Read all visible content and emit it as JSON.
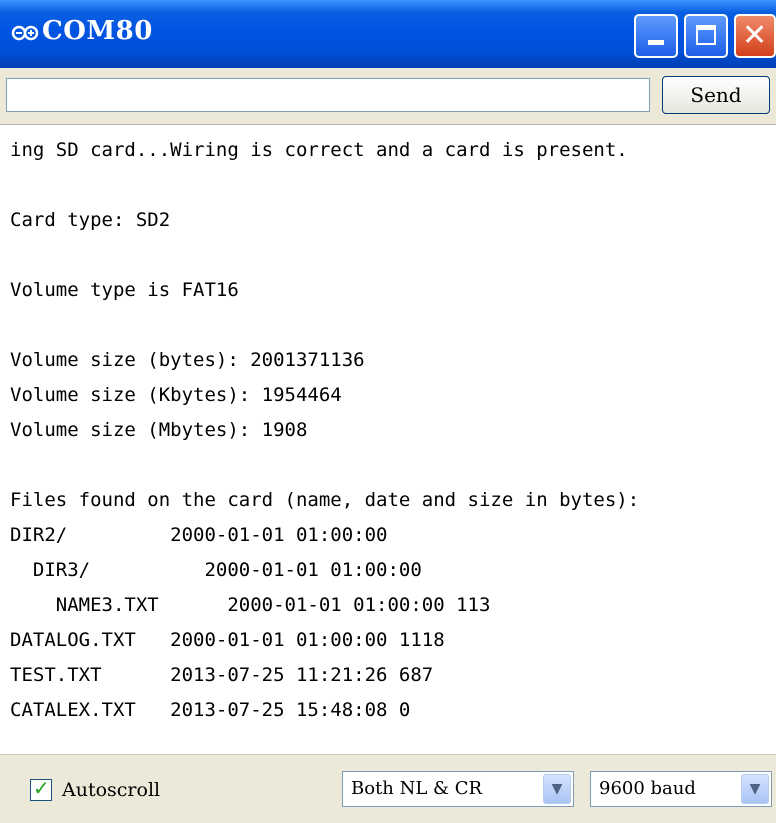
{
  "window": {
    "title": "COM80",
    "icon": "infinity-icon"
  },
  "input_bar": {
    "value": "",
    "send_label": "Send"
  },
  "output_lines": [
    "ing SD card...Wiring is correct and a card is present.",
    "",
    "Card type: SD2",
    "",
    "Volume type is FAT16",
    "",
    "Volume size (bytes): 2001371136",
    "Volume size (Kbytes): 1954464",
    "Volume size (Mbytes): 1908",
    "",
    "Files found on the card (name, date and size in bytes):",
    "DIR2/         2000-01-01 01:00:00",
    "  DIR3/          2000-01-01 01:00:00",
    "    NAME3.TXT      2000-01-01 01:00:00 113",
    "DATALOG.TXT   2000-01-01 01:00:00 1118",
    "TEST.TXT      2013-07-25 11:21:26 687",
    "CATALEX.TXT   2013-07-25 15:48:08 0"
  ],
  "bottom_bar": {
    "autoscroll_label": "Autoscroll",
    "autoscroll_checked": true,
    "line_ending": "Both NL & CR",
    "baud_rate": "9600 baud"
  }
}
